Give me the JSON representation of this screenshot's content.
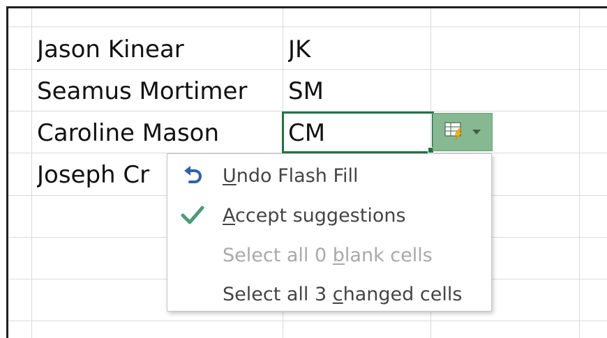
{
  "sheet": {
    "rows": [
      {
        "name": "Jason Kinear",
        "initials": "JK"
      },
      {
        "name": "Seamus Mortimer",
        "initials": "SM"
      },
      {
        "name": "Caroline Mason",
        "initials": "CM"
      },
      {
        "name": "Joseph Cr",
        "initials": ""
      }
    ]
  },
  "flash_fill_options": {
    "icon": "flash-fill-lightning-icon",
    "dropdown_icon": "chevron-down-icon"
  },
  "menu": {
    "items": [
      {
        "pre": "",
        "access_key": "U",
        "post": "ndo Flash Fill",
        "icon": "undo-arrow-icon",
        "enabled": true
      },
      {
        "pre": "",
        "access_key": "A",
        "post": "ccept suggestions",
        "icon": "checkmark-icon",
        "enabled": true
      },
      {
        "pre": "Select all 0 ",
        "access_key": "b",
        "post": "lank cells",
        "icon": "",
        "enabled": false
      },
      {
        "pre": "Select all 3 ",
        "access_key": "c",
        "post": "hanged cells",
        "icon": "",
        "enabled": true
      }
    ]
  },
  "colors": {
    "selection_border": "#217346",
    "button_bg": "#86b891",
    "undo_icon": "#2e62a8",
    "check_icon": "#4e9a7a"
  }
}
